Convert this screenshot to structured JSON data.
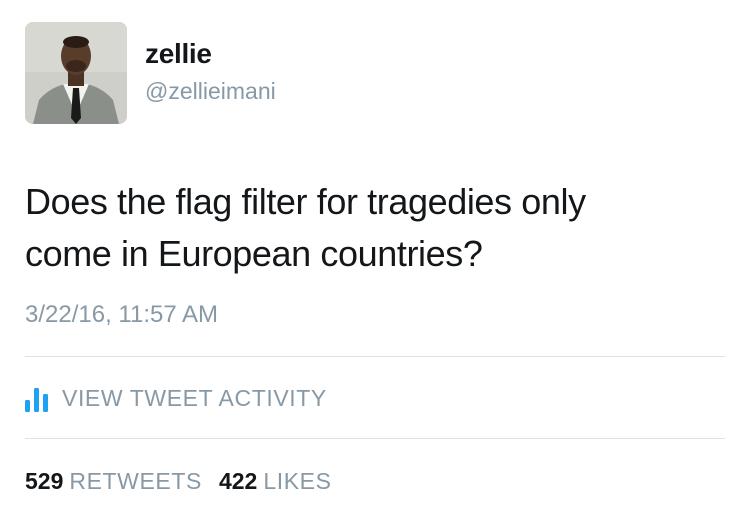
{
  "user": {
    "name": "zellie",
    "handle": "@zellieimani"
  },
  "tweet": {
    "text_line1": "Does the flag filter for tragedies only",
    "text_line2": "come in European countries?",
    "timestamp": "3/22/16, 11:57 AM"
  },
  "activity": {
    "label": "VIEW TWEET ACTIVITY",
    "icon": "bar-chart-icon"
  },
  "stats": {
    "retweets_count": "529",
    "retweets_label": "RETWEETS",
    "likes_count": "422",
    "likes_label": "LIKES"
  },
  "colors": {
    "primary_text": "#14171a",
    "secondary_text": "#8899a6",
    "accent": "#1da1f2",
    "divider": "#dde2e6"
  }
}
